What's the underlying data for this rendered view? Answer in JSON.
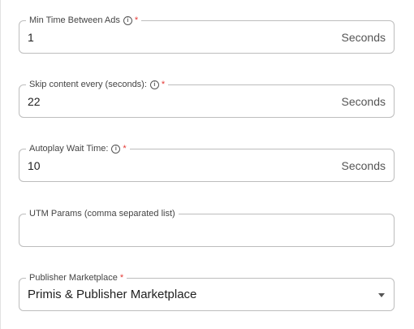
{
  "fields": [
    {
      "label": "Min Time Between Ads",
      "info_icon": "info-icon",
      "required": true,
      "value": "1",
      "suffix": "Seconds"
    },
    {
      "label": "Skip content every (seconds):",
      "info_icon": "info-icon",
      "required": true,
      "value": "22",
      "suffix": "Seconds"
    },
    {
      "label": "Autoplay Wait Time:",
      "info_icon": "info-icon",
      "required": true,
      "value": "10",
      "suffix": "Seconds"
    },
    {
      "label": "UTM Params (comma separated list)",
      "required": false,
      "value": ""
    }
  ],
  "marketplace": {
    "label": "Publisher Marketplace",
    "required": true,
    "selected": "Primis & Publisher Marketplace",
    "caret_icon": "caret-down-icon"
  },
  "required_marker": "*",
  "colors": {
    "border": "#bdbdbd",
    "required": "#e53935",
    "label": "#444444"
  }
}
